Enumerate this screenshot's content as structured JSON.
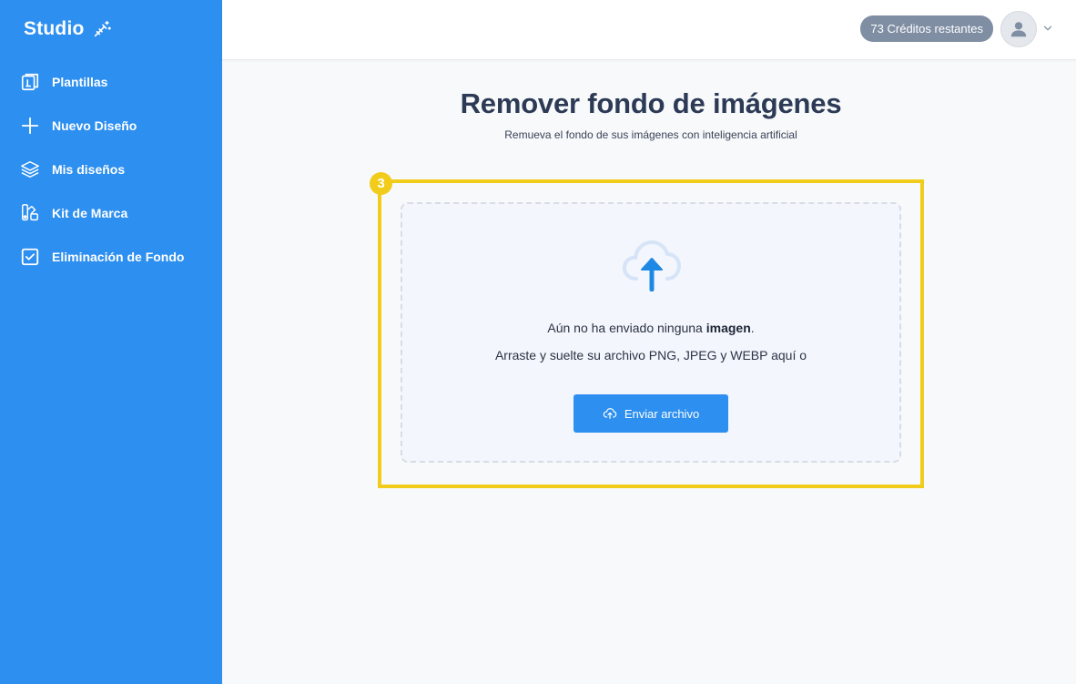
{
  "sidebar": {
    "brand": "Studio",
    "items": [
      {
        "label": "Plantillas",
        "icon": "templates-icon"
      },
      {
        "label": "Nuevo Diseño",
        "icon": "plus-icon"
      },
      {
        "label": "Mis diseños",
        "icon": "layers-icon"
      },
      {
        "label": "Kit de Marca",
        "icon": "brand-kit-icon"
      },
      {
        "label": "Eliminación de Fondo",
        "icon": "checkbox-icon"
      }
    ]
  },
  "header": {
    "credits": "73 Créditos restantes"
  },
  "main": {
    "title": "Remover fondo de imágenes",
    "subtitle": "Remueva el fondo de sus imágenes con inteligencia artificial",
    "step_number": "3",
    "dropzone": {
      "message_prefix": "Aún no ha enviado ninguna ",
      "message_bold": "imagen",
      "message_suffix": ".",
      "instructions": "Arraste y suelte su archivo PNG, JPEG y WEBP aquí o",
      "button_label": "Enviar archivo"
    }
  },
  "colors": {
    "primary": "#2d8fef",
    "highlight": "#f2cc1a",
    "credits_badge": "#7f8ea3",
    "title": "#2c3a55"
  }
}
